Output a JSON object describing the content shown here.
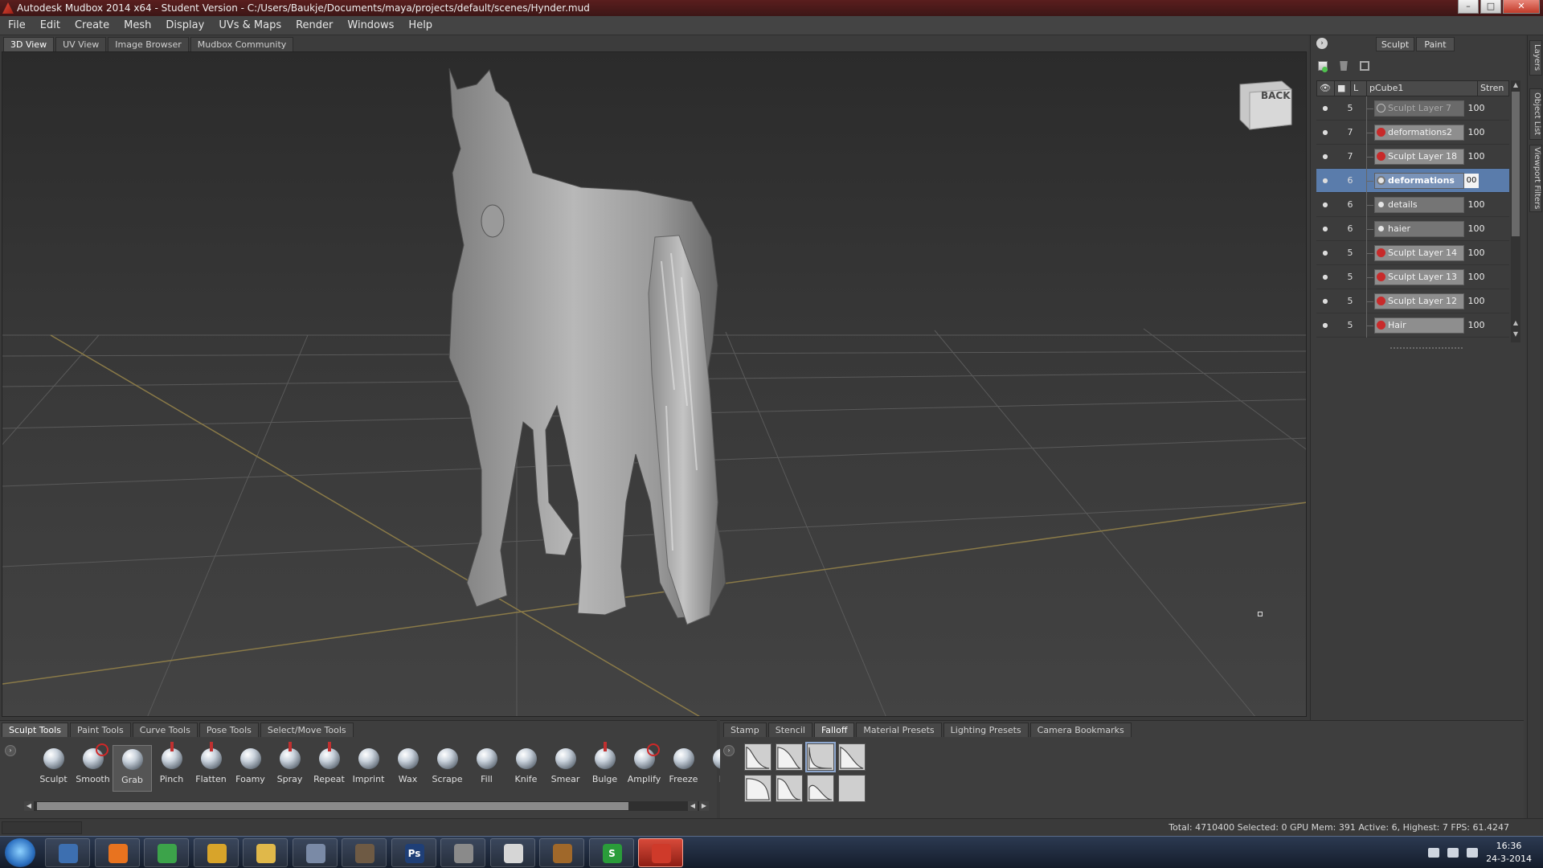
{
  "window": {
    "title": "Autodesk Mudbox 2014 x64 - Student Version - C:/Users/Baukje/Documents/maya/projects/default/scenes/Hynder.mud",
    "controls": [
      "minimize",
      "maximize",
      "close"
    ]
  },
  "menu": [
    "File",
    "Edit",
    "Create",
    "Mesh",
    "Display",
    "UVs & Maps",
    "Render",
    "Windows",
    "Help"
  ],
  "view_tabs": [
    "3D View",
    "UV View",
    "Image Browser",
    "Mudbox Community"
  ],
  "active_view_tab": "3D View",
  "viewcube_label": "BACK",
  "right_panel": {
    "mode_tabs": [
      "Sculpt",
      "Paint"
    ],
    "layer_header": {
      "object": "pCube1",
      "strength": "Stren",
      "level": "L"
    },
    "layers": [
      {
        "level": "5",
        "name": "Sculpt Layer 7",
        "strength": "100",
        "kind": "hollow",
        "style": "dim"
      },
      {
        "level": "7",
        "name": "deformations2",
        "strength": "100",
        "kind": "sculpt",
        "style": "normal"
      },
      {
        "level": "7",
        "name": "Sculpt Layer 18",
        "strength": "100",
        "kind": "sculpt",
        "style": "normal"
      },
      {
        "level": "6",
        "name": "deformations",
        "strength": "00",
        "kind": "paint",
        "style": "selected"
      },
      {
        "level": "6",
        "name": "details",
        "strength": "100",
        "kind": "paint",
        "style": "flat"
      },
      {
        "level": "6",
        "name": "haier",
        "strength": "100",
        "kind": "paint",
        "style": "flat"
      },
      {
        "level": "5",
        "name": "Sculpt Layer 14",
        "strength": "100",
        "kind": "sculpt",
        "style": "normal"
      },
      {
        "level": "5",
        "name": "Sculpt Layer 13",
        "strength": "100",
        "kind": "sculpt",
        "style": "normal"
      },
      {
        "level": "5",
        "name": "Sculpt Layer 12",
        "strength": "100",
        "kind": "sculpt",
        "style": "normal"
      },
      {
        "level": "5",
        "name": "Hair",
        "strength": "100",
        "kind": "sculpt",
        "style": "normal"
      }
    ],
    "side_tabs": [
      "Layers",
      "Object List",
      "Viewport Filters"
    ]
  },
  "tool_tabs": [
    "Sculpt Tools",
    "Paint Tools",
    "Curve Tools",
    "Pose Tools",
    "Select/Move Tools"
  ],
  "active_tool_tab": "Sculpt Tools",
  "tools": [
    {
      "label": "Sculpt",
      "mark": ""
    },
    {
      "label": "Smooth",
      "mark": "red"
    },
    {
      "label": "Grab",
      "mark": ""
    },
    {
      "label": "Pinch",
      "mark": "pin"
    },
    {
      "label": "Flatten",
      "mark": "pin"
    },
    {
      "label": "Foamy",
      "mark": ""
    },
    {
      "label": "Spray",
      "mark": "pin"
    },
    {
      "label": "Repeat",
      "mark": "pin"
    },
    {
      "label": "Imprint",
      "mark": ""
    },
    {
      "label": "Wax",
      "mark": ""
    },
    {
      "label": "Scrape",
      "mark": ""
    },
    {
      "label": "Fill",
      "mark": ""
    },
    {
      "label": "Knife",
      "mark": ""
    },
    {
      "label": "Smear",
      "mark": ""
    },
    {
      "label": "Bulge",
      "mark": "pin"
    },
    {
      "label": "Amplify",
      "mark": "red"
    },
    {
      "label": "Freeze",
      "mark": ""
    },
    {
      "label": "M",
      "mark": ""
    }
  ],
  "active_tool": "Grab",
  "tray_tabs": [
    "Stamp",
    "Stencil",
    "Falloff",
    "Material Presets",
    "Lighting Presets",
    "Camera Bookmarks"
  ],
  "active_tray_tab": "Falloff",
  "falloff_presets": [
    {
      "curve": "linear-decay"
    },
    {
      "curve": "concave"
    },
    {
      "curve": "steep"
    },
    {
      "curve": "soft"
    },
    {
      "curve": "convex"
    },
    {
      "curve": "s-curve"
    },
    {
      "curve": "bell"
    },
    {
      "curve": "flat"
    }
  ],
  "active_falloff": 2,
  "status": {
    "text": "Total: 4710400  Selected: 0 GPU Mem: 391  Active: 6, Highest: 7  FPS: 61.4247"
  },
  "taskbar": {
    "apps": [
      {
        "name": "network-app",
        "glyph": ""
      },
      {
        "name": "firefox",
        "glyph": ""
      },
      {
        "name": "chrome",
        "glyph": ""
      },
      {
        "name": "media-player",
        "glyph": ""
      },
      {
        "name": "file-explorer",
        "glyph": ""
      },
      {
        "name": "window-app",
        "glyph": ""
      },
      {
        "name": "game-app",
        "glyph": ""
      },
      {
        "name": "photoshop",
        "glyph": "Ps"
      },
      {
        "name": "settings",
        "glyph": ""
      },
      {
        "name": "unity",
        "glyph": ""
      },
      {
        "name": "game-launcher",
        "glyph": ""
      },
      {
        "name": "s-app",
        "glyph": "S"
      },
      {
        "name": "mudbox",
        "glyph": ""
      }
    ],
    "clock_time": "16:36",
    "clock_date": "24-3-2014"
  },
  "colors": {
    "selection": "#5a7cab",
    "sculpt_layer": "#c82a2a",
    "ground_axis": "#8a7a48",
    "titlebar": "#5a1e1e"
  }
}
